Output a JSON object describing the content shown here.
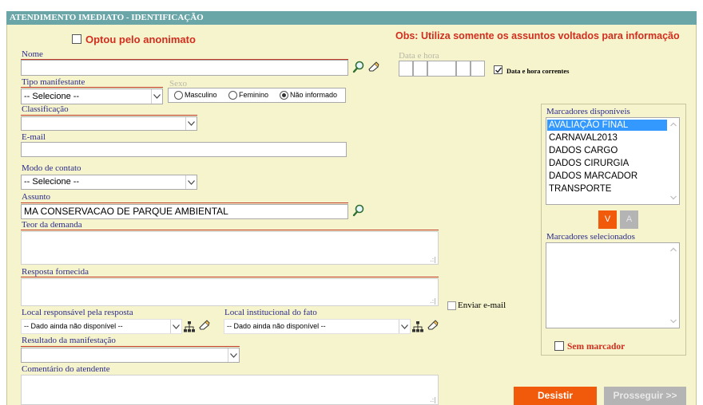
{
  "header": {
    "title": "ATENDIMENTO IMEDIATO - IDENTIFICAÇÃO"
  },
  "anon": {
    "label": "Optou pelo anonimato"
  },
  "obs": {
    "text": "Obs: Utiliza somente os assuntos voltados para informação"
  },
  "nome": {
    "label": "Nome",
    "value": ""
  },
  "datahora": {
    "label": "Data e hora",
    "current_label": "Data e hora correntes"
  },
  "tipo": {
    "label": "Tipo manifestante",
    "value": "-- Selecione --"
  },
  "sexo": {
    "label": "Sexo",
    "options": [
      "Masculino",
      "Feminino",
      "Não informado"
    ],
    "selected": "Não informado"
  },
  "classificacao": {
    "label": "Classificação",
    "value": ""
  },
  "email": {
    "label": "E-mail",
    "value": ""
  },
  "modo": {
    "label": "Modo de contato",
    "value": "-- Selecione --"
  },
  "assunto": {
    "label": "Assunto",
    "value": "MA CONSERVACAO DE PARQUE AMBIENTAL"
  },
  "teor": {
    "label": "Teor da demanda"
  },
  "resposta": {
    "label": "Resposta fornecida"
  },
  "enviar": {
    "label": "Enviar e-mail"
  },
  "local_resp": {
    "label": "Local responsável pela resposta",
    "value": "-- Dado ainda não disponível --"
  },
  "local_inst": {
    "label": "Local institucional do fato",
    "value": "-- Dado ainda não disponível --"
  },
  "resultado": {
    "label": "Resultado da manifestação",
    "value": ""
  },
  "comentario": {
    "label": "Comentário do atendente"
  },
  "marcadores": {
    "available_label": "Marcadores disponíveis",
    "available": [
      "AVALIAÇÃO FINAL",
      "CARNAVAL2013",
      "DADOS CARGO",
      "DADOS CIRURGIA",
      "DADOS MARCADOR",
      "TRANSPORTE"
    ],
    "selected_item": "AVALIAÇÃO FINAL",
    "btn_v": "V",
    "btn_a": "A",
    "selected_label": "Marcadores selecionados",
    "sem_label": "Sem marcador"
  },
  "buttons": {
    "desistir": "Desistir",
    "prosseguir": "Prosseguir >>"
  },
  "colors": {
    "header": "#6aa6a8",
    "panel": "#f6f4cc",
    "accent_red": "#d12e1f",
    "button_orange": "#f05a0a",
    "button_gray": "#b4b4b4",
    "selection_blue": "#3399ff",
    "label_blue": "#2a2a8c"
  }
}
